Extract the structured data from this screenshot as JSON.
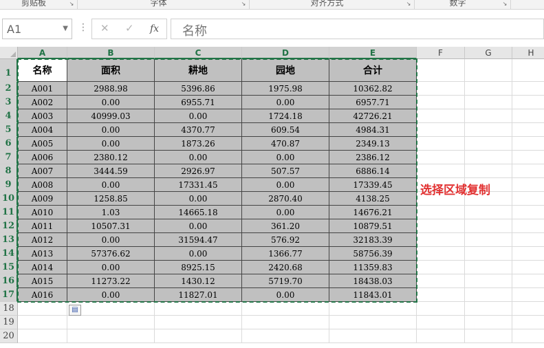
{
  "ribbon": {
    "groups": [
      {
        "label": "剪贴板"
      },
      {
        "label": "字体"
      },
      {
        "label": "对齐方式"
      },
      {
        "label": "数字"
      }
    ]
  },
  "formula_bar": {
    "name_box": "A1",
    "cancel_symbol": "✕",
    "enter_symbol": "✓",
    "fx_symbol": "fx",
    "content": "名称"
  },
  "columns": [
    "A",
    "B",
    "C",
    "D",
    "E",
    "F",
    "G",
    "H"
  ],
  "rows": [
    "1",
    "2",
    "3",
    "4",
    "5",
    "6",
    "7",
    "8",
    "9",
    "10",
    "11",
    "12",
    "13",
    "14",
    "15",
    "16",
    "17",
    "18",
    "19",
    "20"
  ],
  "table": {
    "headers": [
      "名称",
      "面积",
      "耕地",
      "园地",
      "合计"
    ],
    "rows": [
      [
        "A001",
        "2988.98",
        "5396.86",
        "1975.98",
        "10362.82"
      ],
      [
        "A002",
        "0.00",
        "6955.71",
        "0.00",
        "6957.71"
      ],
      [
        "A003",
        "40999.03",
        "0.00",
        "1724.18",
        "42726.21"
      ],
      [
        "A004",
        "0.00",
        "4370.77",
        "609.54",
        "4984.31"
      ],
      [
        "A005",
        "0.00",
        "1873.26",
        "470.87",
        "2349.13"
      ],
      [
        "A006",
        "2380.12",
        "0.00",
        "0.00",
        "2386.12"
      ],
      [
        "A007",
        "3444.59",
        "2926.97",
        "507.57",
        "6886.14"
      ],
      [
        "A008",
        "0.00",
        "17331.45",
        "0.00",
        "17339.45"
      ],
      [
        "A009",
        "1258.85",
        "0.00",
        "2870.40",
        "4138.25"
      ],
      [
        "A010",
        "1.03",
        "14665.18",
        "0.00",
        "14676.21"
      ],
      [
        "A011",
        "10507.31",
        "0.00",
        "361.20",
        "10879.51"
      ],
      [
        "A012",
        "0.00",
        "31594.47",
        "576.92",
        "32183.39"
      ],
      [
        "A013",
        "57376.62",
        "0.00",
        "1366.77",
        "58756.39"
      ],
      [
        "A014",
        "0.00",
        "8925.15",
        "2420.68",
        "11359.83"
      ],
      [
        "A015",
        "11273.22",
        "1430.12",
        "5719.70",
        "18438.03"
      ],
      [
        "A016",
        "0.00",
        "11827.01",
        "0.00",
        "11843.01"
      ]
    ]
  },
  "annotation": "选择区域复制",
  "colors": {
    "selection_border": "#217346",
    "cell_fill": "#c0c0c0",
    "annotation_text": "#e23232"
  },
  "icons": {
    "paste_options": "paste-options-icon",
    "launcher": "dialog-launcher-icon"
  }
}
